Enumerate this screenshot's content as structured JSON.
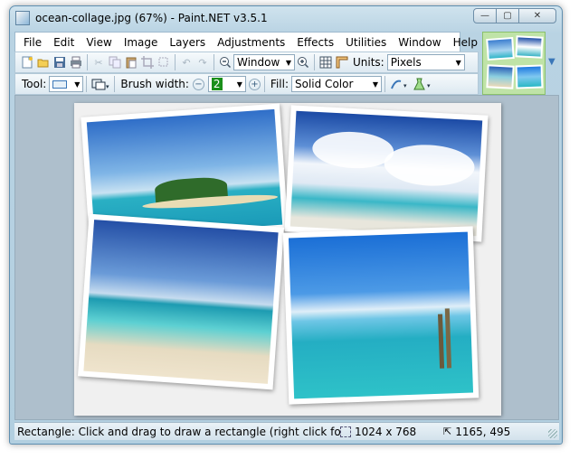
{
  "window": {
    "title": "ocean-collage.jpg (67%) - Paint.NET v3.5.1",
    "controls": {
      "minimize": "—",
      "maximize": "▢",
      "close": "✕"
    }
  },
  "menu": [
    "File",
    "Edit",
    "View",
    "Image",
    "Layers",
    "Adjustments",
    "Effects",
    "Utilities",
    "Window",
    "Help"
  ],
  "toolbar1": {
    "zoom_combo": "Window",
    "units_label": "Units:",
    "units_value": "Pixels"
  },
  "toolbar2": {
    "tool_label": "Tool:",
    "brush_width_label": "Brush width:",
    "brush_width_value": "2",
    "fill_label": "Fill:",
    "fill_value": "Solid Color"
  },
  "status": {
    "message": "Rectangle: Click and drag to draw a rectangle (right click for second",
    "image_size": "1024 x 768",
    "cursor_position": "1165, 495"
  },
  "colors": {
    "accent": "#3a76b8",
    "canvas_bg": "#aebfcc",
    "thumb_panel": "#bfe3a7"
  },
  "icons": [
    "new-icon",
    "open-icon",
    "save-icon",
    "print-icon",
    "cut-icon",
    "copy-icon",
    "paste-icon",
    "crop-icon",
    "deselect-icon",
    "undo-icon",
    "redo-icon",
    "zoom-out-icon",
    "zoom-in-icon",
    "grid-icon",
    "ruler-icon",
    "rectangle-tool-icon",
    "shape-type-icon",
    "minus-icon",
    "plus-icon",
    "antialias-icon",
    "alpha-blend-icon"
  ]
}
